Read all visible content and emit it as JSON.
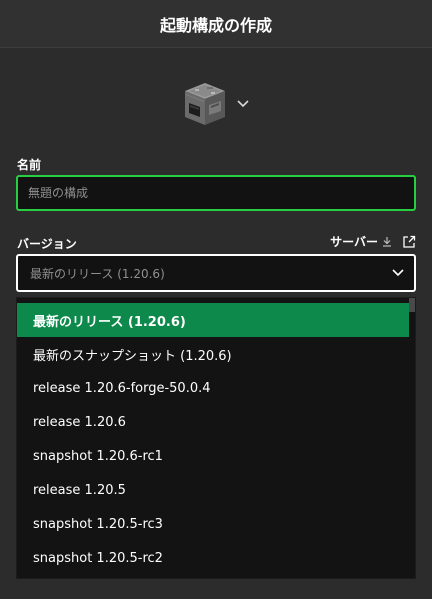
{
  "header": {
    "title": "起動構成の作成"
  },
  "icon_picker": {
    "icon": "furnace-block-icon",
    "chevron": "chevron-down-icon"
  },
  "name_field": {
    "label": "名前",
    "placeholder": "無題の構成",
    "value": ""
  },
  "version_field": {
    "label": "バージョン",
    "server_link_label": "サーバー",
    "server_icons": [
      "download-icon",
      "external-link-icon"
    ],
    "selected_value": "最新のリリース (1.20.6)"
  },
  "dropdown": {
    "options": [
      {
        "label": "最新のリリース (1.20.6)",
        "selected": true
      },
      {
        "label": "最新のスナップショット (1.20.6)",
        "selected": false
      },
      {
        "label": "release 1.20.6-forge-50.0.4",
        "selected": false
      },
      {
        "label": "release 1.20.6",
        "selected": false
      },
      {
        "label": "snapshot 1.20.6-rc1",
        "selected": false
      },
      {
        "label": "release 1.20.5",
        "selected": false
      },
      {
        "label": "snapshot 1.20.5-rc3",
        "selected": false
      },
      {
        "label": "snapshot 1.20.5-rc2",
        "selected": false
      }
    ]
  },
  "colors": {
    "background": "#2c2c2c",
    "accent_green": "#27ce40",
    "selected_option": "#0d8a4b",
    "input_background": "#121212"
  }
}
